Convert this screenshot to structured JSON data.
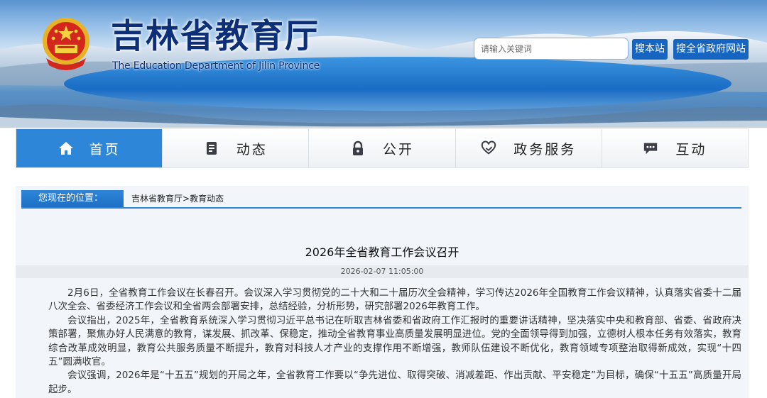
{
  "header": {
    "title": "吉林省教育厅",
    "subtitle": "The Education Department of Jilin Province",
    "emblem": "national-emblem"
  },
  "search": {
    "placeholder": "请输入关键词",
    "value": "",
    "search_site_label": "搜本站",
    "search_gov_label": "搜全省政府网站"
  },
  "nav": {
    "items": [
      {
        "label": "首页",
        "icon": "home-icon",
        "active": true
      },
      {
        "label": "动态",
        "icon": "document-icon",
        "active": false
      },
      {
        "label": "公开",
        "icon": "lock-icon",
        "active": false
      },
      {
        "label": "政务服务",
        "icon": "heart-hands-icon",
        "active": false
      },
      {
        "label": "互动",
        "icon": "chat-bubble-icon",
        "active": false
      }
    ]
  },
  "breadcrumb": {
    "label": "您现在的位置：",
    "path": [
      {
        "label": "吉林省教育厅"
      },
      {
        "label": "教育动态"
      }
    ],
    "separator": ">"
  },
  "article": {
    "title": "2026年全省教育工作会议召开",
    "date": "2026-02-07 11:05:00",
    "paragraphs": [
      "2月6日，全省教育工作会议在长春召开。会议深入学习贯彻党的二十大和二十届历次全会精神，学习传达2026年全国教育工作会议精神，认真落实省委十二届八次全会、省委经济工作会议和全省两会部署安排，总结经验，分析形势，研究部署2026年教育工作。",
      "会议指出，2025年，全省教育系统深入学习贯彻习近平总书记在听取吉林省委和省政府工作汇报时的重要讲话精神，坚决落实中央和教育部、省委、省政府决策部署，聚焦办好人民满意的教育，谋发展、抓改革、保稳定，推动全省教育事业高质量发展明显进位。党的全面领导得到加强，立德树人根本任务有效落实，教育综合改革成效明显，教育公共服务质量不断提升，教育对科技人才产业的支撑作用不断增强，教师队伍建设不断优化，教育领域专项整治取得新成效，实现“十四五”圆满收官。",
      "会议强调，2026年是“十五五”规划的开局之年，全省教育工作要以“争先进位、取得突破、消减差距、作出贡献、平安稳定”为目标，确保“十五五”高质量开局起步。"
    ]
  },
  "colors": {
    "brand_blue": "#2e86d8",
    "button_blue": "#1665c1",
    "title_navy": "#0d2f78"
  }
}
